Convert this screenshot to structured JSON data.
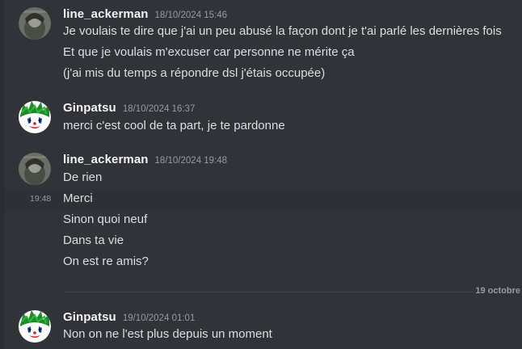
{
  "messages": [
    {
      "username": "line_ackerman",
      "timestamp": "18/10/2024 15:46",
      "avatar": "line-ackerman-avatar",
      "lines": [
        "Je voulais te dire que j'ai un peu abusé la façon dont je t'ai parlé les dernières fois",
        "Et que je voulais m'excuser car personne ne mérite ça",
        "(j'ai mis du temps a répondre dsl j'étais occupée)"
      ]
    },
    {
      "username": "Ginpatsu",
      "timestamp": "18/10/2024 16:37",
      "avatar": "ginpatsu-avatar",
      "lines": [
        "merci c'est cool de ta part, je te pardonne"
      ]
    },
    {
      "username": "line_ackerman",
      "timestamp": "18/10/2024 19:48",
      "avatar": "line-ackerman-avatar",
      "lines": [
        "De rien",
        "Merci",
        "Sinon quoi neuf",
        "Dans ta vie",
        "On est re amis?"
      ],
      "hover_time": "19:48"
    },
    {
      "username": "Ginpatsu",
      "timestamp": "19/10/2024 01:01",
      "avatar": "ginpatsu-avatar",
      "lines": [
        "Non on ne l'est plus depuis un moment"
      ]
    }
  ],
  "date_divider": "19 octobre",
  "colors": {
    "background": "#313338",
    "username": "#f2f3f5",
    "text": "#dbdee1",
    "muted": "#949ba4"
  }
}
